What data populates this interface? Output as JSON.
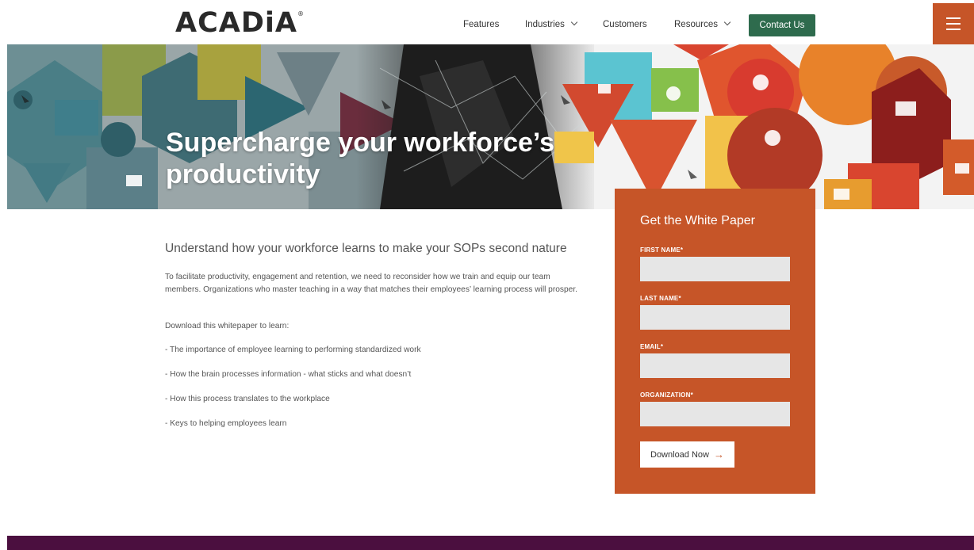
{
  "brand": {
    "logo": "ACADiA",
    "trademark": "®"
  },
  "nav": {
    "features": "Features",
    "industries": "Industries",
    "customers": "Customers",
    "resources": "Resources",
    "contact": "Contact Us"
  },
  "hero": {
    "title_line1": "Supercharge your workforce’s",
    "title_line2": "productivity"
  },
  "content": {
    "subtitle": "Understand how your workforce learns to make your SOPs second nature",
    "intro": "To facilitate productivity, engagement and retention, we need to reconsider how we train and equip our team members. Organizations who master teaching in a way that matches their employees’ learning process will prosper.",
    "lead": "Download this whitepaper to learn:",
    "bullets": [
      "- The importance of employee learning to performing standardized work",
      "- How the brain processes information - what sticks and what doesn’t",
      "- How this process translates to the workplace",
      "- Keys to helping employees learn"
    ]
  },
  "form": {
    "title": "Get the White Paper",
    "fields": [
      {
        "label": "FIRST NAME*",
        "value": ""
      },
      {
        "label": "LAST NAME*",
        "value": ""
      },
      {
        "label": "EMAIL*",
        "value": ""
      },
      {
        "label": "ORGANIZATION*",
        "value": ""
      }
    ],
    "submit": "Download Now",
    "submit_icon": "→"
  },
  "colors": {
    "accent": "#c65528",
    "contact_button": "#2e6b4d",
    "footer": "#4b0f3f"
  },
  "icons": [
    "menu-icon",
    "chevron-down-icon",
    "arrow-right-icon"
  ]
}
